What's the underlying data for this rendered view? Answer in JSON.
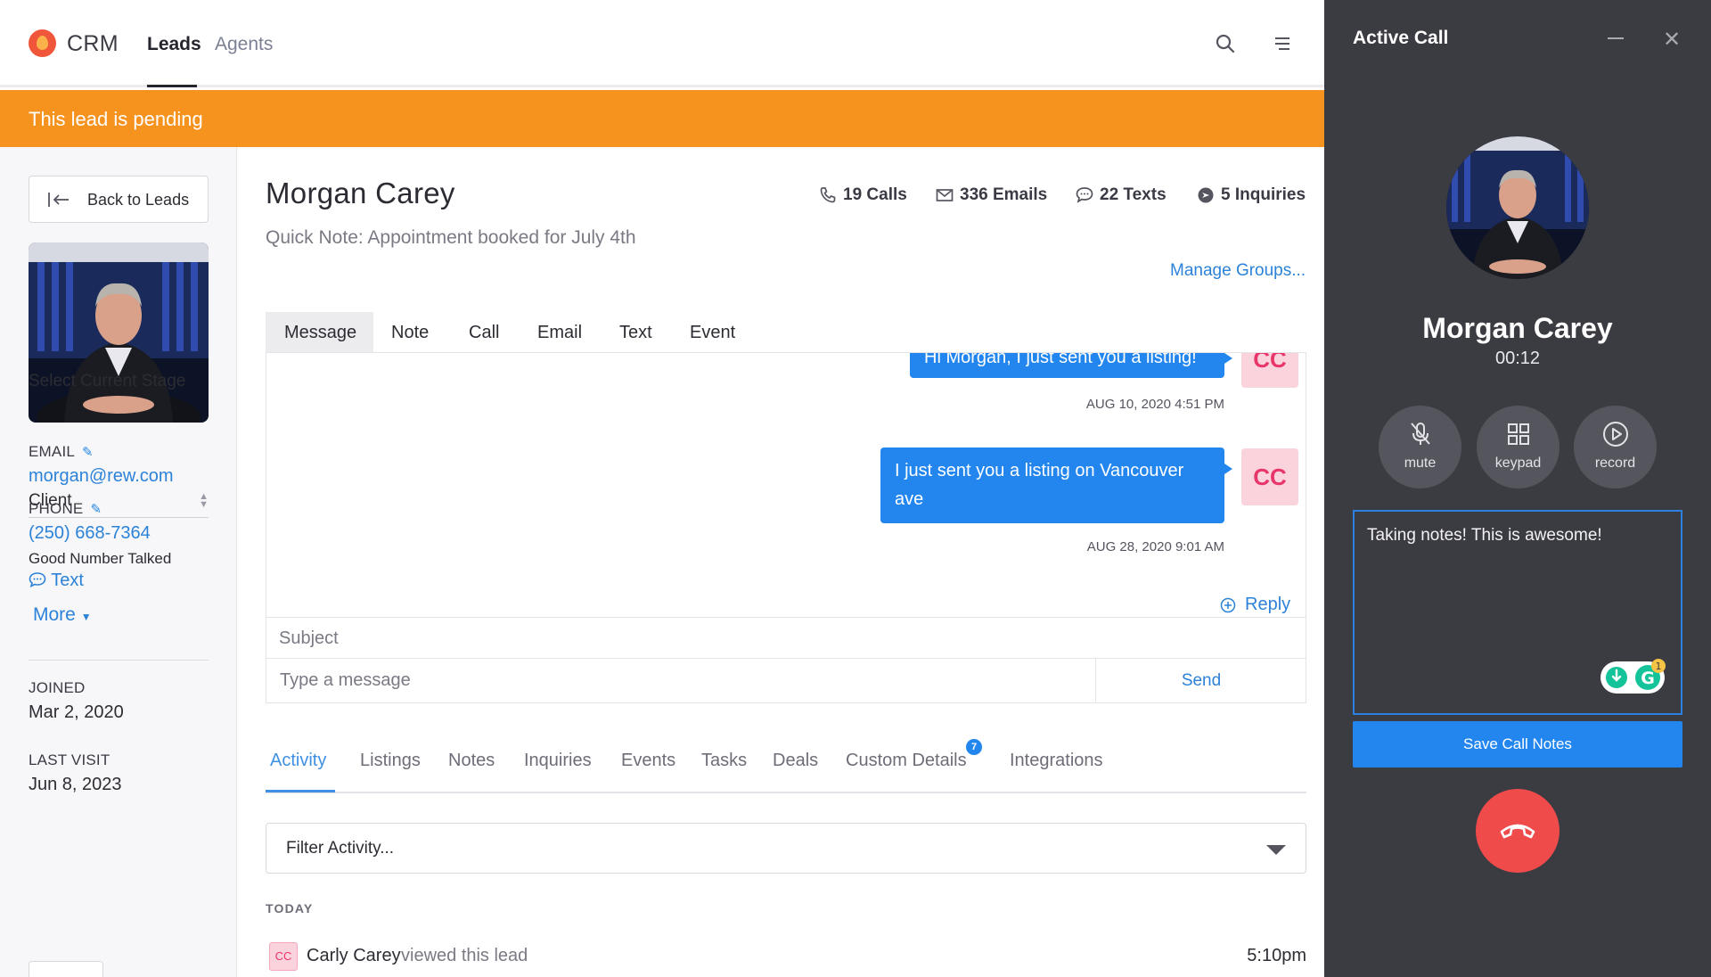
{
  "app": {
    "brand": "CRM",
    "nav": [
      {
        "label": "Leads",
        "active": true
      },
      {
        "label": "Agents",
        "active": false
      }
    ],
    "icons": {
      "search": "search-icon",
      "menu": "hamburger-menu-icon"
    }
  },
  "banner": {
    "text": "This lead is pending",
    "color": "#f6921e"
  },
  "sidebar": {
    "back_label": "Back to Leads",
    "stage_heading": "Select Current Stage",
    "stage_value": "Client",
    "email_label": "EMAIL",
    "email_value": "morgan@rew.com",
    "phone_label": "PHONE",
    "phone_value": "(250) 668-7364",
    "phone_status": "Good Number Talked",
    "text_link": "Text",
    "more_link": "More",
    "joined_label": "JOINED",
    "joined_value": "Mar 2, 2020",
    "last_visit_label": "LAST VISIT",
    "last_visit_value": "Jun 8, 2023"
  },
  "lead": {
    "name": "Morgan Carey",
    "quick_note": "Quick Note: Appointment booked for July 4th",
    "stats": {
      "calls": "19 Calls",
      "emails": "336 Emails",
      "texts": "22 Texts",
      "inquiries": "5 Inquiries"
    },
    "manage_groups": "Manage Groups..."
  },
  "composer": {
    "tabs": [
      "Message",
      "Note",
      "Call",
      "Email",
      "Text",
      "Event"
    ],
    "active_tab": "Message",
    "messages": [
      {
        "text": "Hi Morgan, I just sent you a listing!",
        "time": "AUG 10, 2020 4:51 PM",
        "avatar": "CC"
      },
      {
        "text": "I just sent you a listing on Vancouver ave",
        "time": "AUG 28, 2020 9:01 AM",
        "avatar": "CC"
      }
    ],
    "reply_label": "Reply",
    "subject_placeholder": "Subject",
    "message_placeholder": "Type a message",
    "send_label": "Send"
  },
  "activity": {
    "tabs": [
      "Activity",
      "Listings",
      "Notes",
      "Inquiries",
      "Events",
      "Tasks",
      "Deals",
      "Custom Details",
      "Integrations"
    ],
    "active_tab": "Activity",
    "custom_details_badge": "7",
    "filter_label": "Filter Activity...",
    "section_label": "TODAY",
    "rows": [
      {
        "avatar": "CC",
        "who": "Carly Carey",
        "what": "viewed this lead",
        "when": "5:10pm"
      }
    ]
  },
  "call": {
    "title": "Active Call",
    "name": "Morgan Carey",
    "timer": "00:12",
    "buttons": [
      {
        "label": "mute",
        "icon": "microphone-off-icon"
      },
      {
        "label": "keypad",
        "icon": "keypad-grid-icon"
      },
      {
        "label": "record",
        "icon": "play-circle-icon"
      }
    ],
    "notes_text": "Taking notes! This is awesome!",
    "grammarly_badge": "1",
    "save_label": "Save Call Notes",
    "hangup_icon": "hang-up-phone-icon",
    "colors": {
      "panel": "#3b3b42",
      "accent": "#2286ee",
      "hangup": "#ef4b4b"
    }
  }
}
